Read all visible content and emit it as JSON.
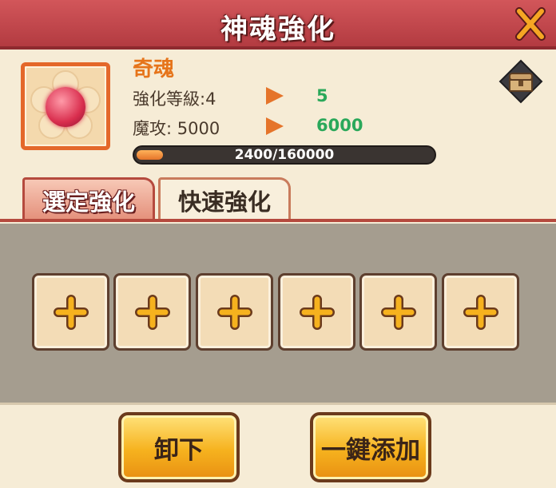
{
  "header": {
    "title": "神魂強化",
    "close_icon": "close-x-icon"
  },
  "soul": {
    "name": "奇魂",
    "level_label": "強化等級:4",
    "level_next": "5",
    "stat_label": "魔攻: 5000",
    "stat_next": "6000",
    "exp_text": "2400/160000",
    "exp_progress": 0.015
  },
  "tabs": [
    {
      "label": "選定強化",
      "active": true
    },
    {
      "label": "快速強化",
      "active": false
    }
  ],
  "slots": [
    {
      "icon": "add-plus-icon"
    },
    {
      "icon": "add-plus-icon"
    },
    {
      "icon": "add-plus-icon"
    },
    {
      "icon": "add-plus-icon"
    },
    {
      "icon": "add-plus-icon"
    },
    {
      "icon": "add-plus-icon"
    }
  ],
  "buttons": {
    "unequip": "卸下",
    "auto_add": "一鍵添加"
  },
  "colors": {
    "header": "#c14a4f",
    "accent": "#e5742a",
    "green": "#2aa85a",
    "button": "#f6b21e"
  }
}
